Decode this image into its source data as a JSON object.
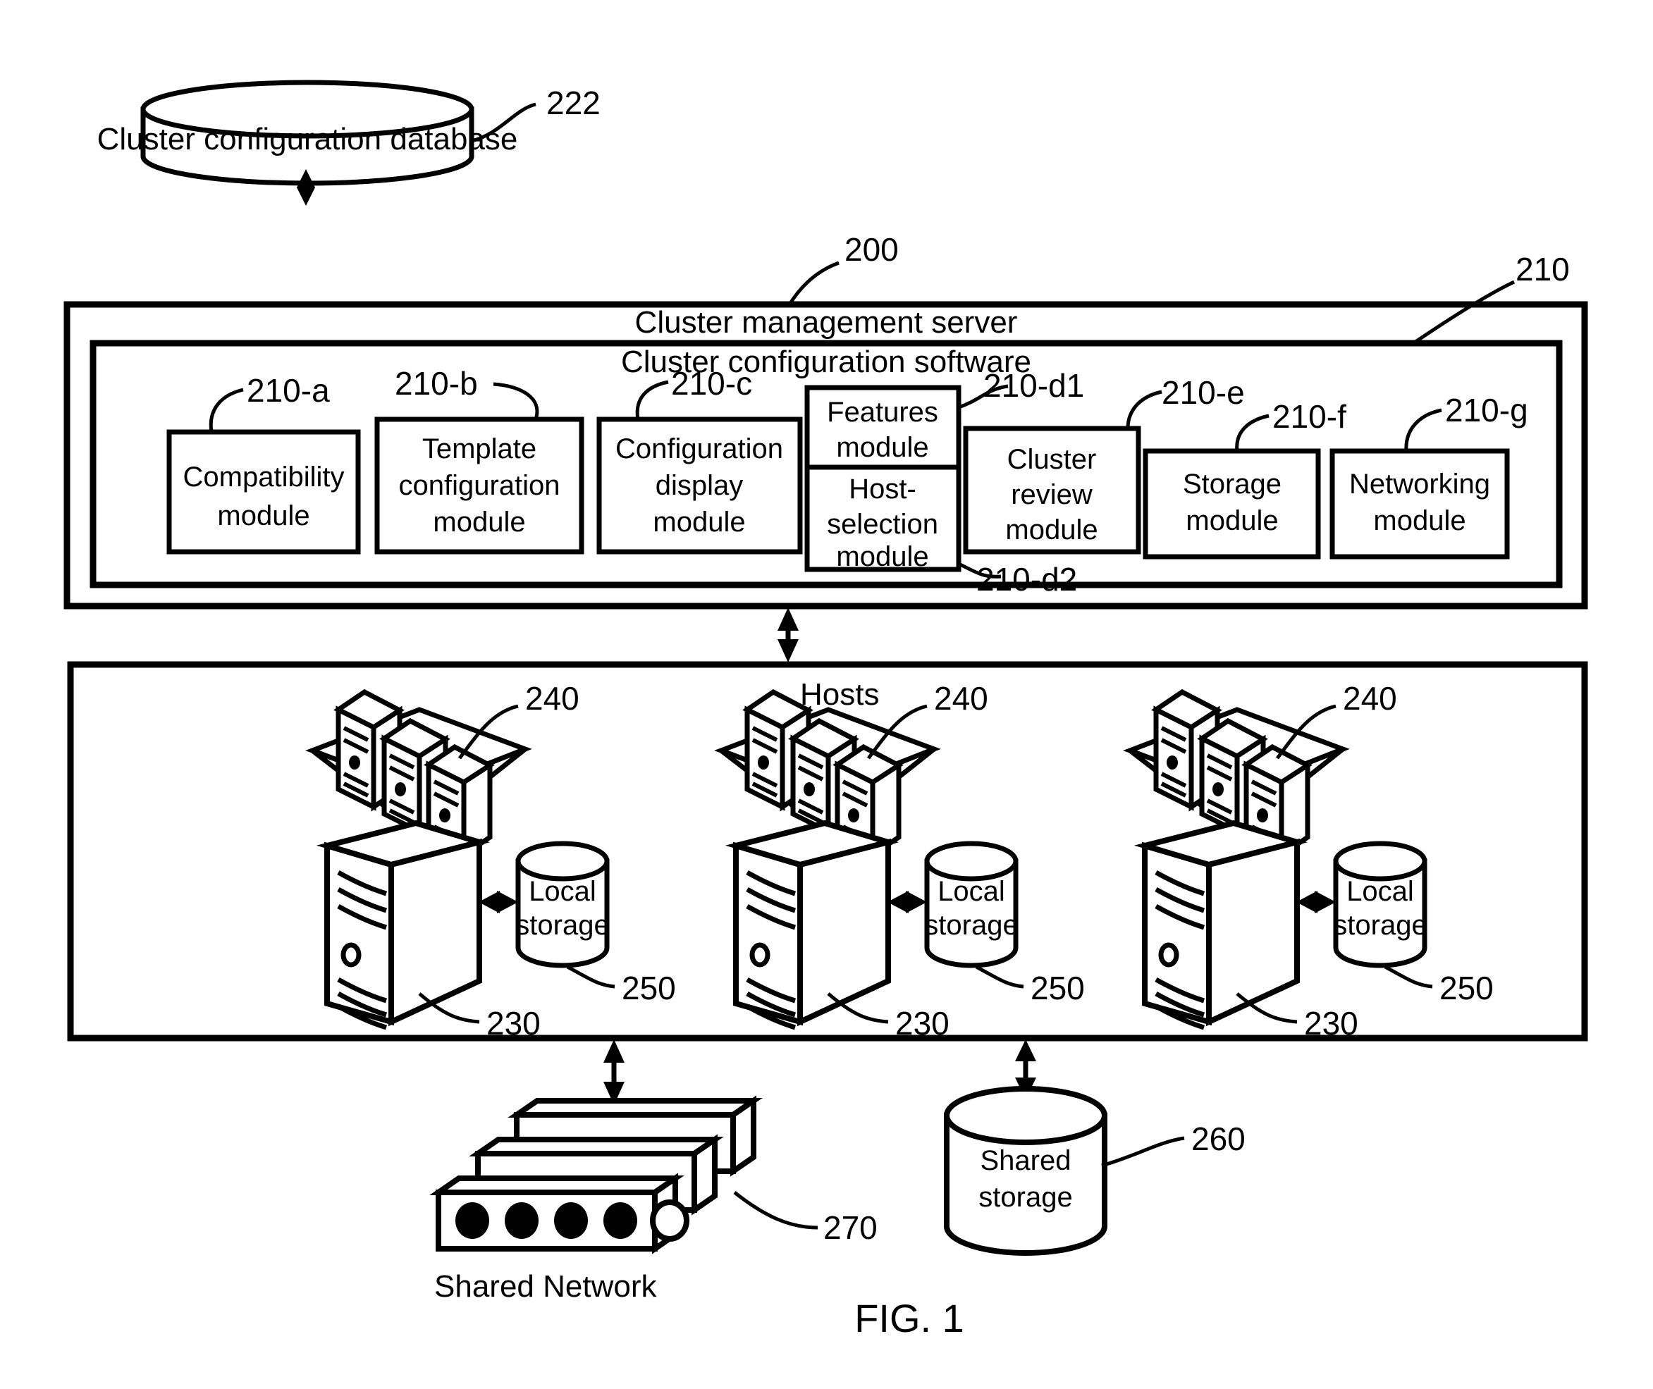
{
  "figure": {
    "caption": "FIG. 1"
  },
  "database": {
    "label": "Cluster configuration database",
    "ref": "222"
  },
  "server": {
    "title": "Cluster management server",
    "ref": "200",
    "software": {
      "title": "Cluster configuration software",
      "ref": "210",
      "modules": [
        {
          "id": "compatibility",
          "ref": "210-a",
          "lines": [
            "Compatibility",
            "module"
          ]
        },
        {
          "id": "template",
          "ref": "210-b",
          "lines": [
            "Template",
            "configuration",
            "module"
          ]
        },
        {
          "id": "config-display",
          "ref": "210-c",
          "lines": [
            "Configuration",
            "display",
            "module"
          ]
        },
        {
          "id": "features",
          "ref": "210-d1",
          "lines": [
            "Features",
            "module"
          ]
        },
        {
          "id": "host-selection",
          "ref": "210-d2",
          "lines": [
            "Host-",
            "selection",
            "module"
          ]
        },
        {
          "id": "cluster-review",
          "ref": "210-e",
          "lines": [
            "Cluster",
            "review",
            "module"
          ]
        },
        {
          "id": "storage",
          "ref": "210-f",
          "lines": [
            "Storage",
            "module"
          ]
        },
        {
          "id": "networking",
          "ref": "210-g",
          "lines": [
            "Networking",
            "module"
          ]
        }
      ]
    }
  },
  "hosts": {
    "label": "Hosts",
    "groups": [
      {
        "host_ref": "230",
        "vm_ref": "240",
        "storage_ref": "250",
        "storage_lines": [
          "Local",
          "storage"
        ]
      },
      {
        "host_ref": "230",
        "vm_ref": "240",
        "storage_ref": "250",
        "storage_lines": [
          "Local",
          "storage"
        ]
      },
      {
        "host_ref": "230",
        "vm_ref": "240",
        "storage_ref": "250",
        "storage_lines": [
          "Local",
          "storage"
        ]
      }
    ]
  },
  "network": {
    "label": "Shared Network",
    "ref": "270"
  },
  "shared_storage": {
    "lines": [
      "Shared",
      "storage"
    ],
    "ref": "260"
  },
  "colors": {
    "ink": "#000000",
    "paper": "#ffffff"
  }
}
